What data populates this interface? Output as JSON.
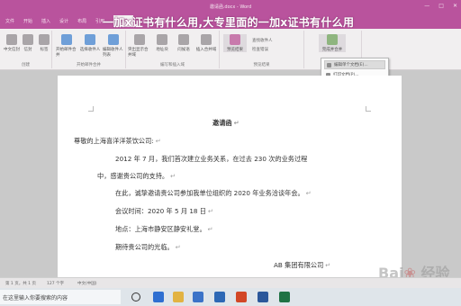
{
  "window": {
    "title": "邀请函.docx - Word",
    "controls": [
      "—",
      "□",
      "✕"
    ]
  },
  "headline": "一加x证书有什么用,大专里面的一加x证书有什么用",
  "tabs": [
    "文件",
    "开始",
    "插入",
    "设计",
    "布局",
    "引用",
    "邮件",
    "审阅",
    "视图"
  ],
  "active_tab": "邮件",
  "ribbon": {
    "groups": [
      {
        "label": "创建",
        "buttons": [
          "中文信封",
          "信封",
          "标签"
        ]
      },
      {
        "label": "开始邮件合并",
        "buttons": [
          "开始邮件合并",
          "选择收件人",
          "编辑收件人列表"
        ]
      },
      {
        "label": "编写和插入域",
        "buttons": [
          "突出显示合并域",
          "地址块",
          "问候语",
          "插入合并域"
        ]
      },
      {
        "label": "预览结果",
        "buttons": [
          "预览结果"
        ],
        "lines": [
          "查找收件人",
          "检查错误"
        ]
      },
      {
        "label": "完成",
        "buttons": [
          "完成并合并"
        ]
      }
    ]
  },
  "dropdown": {
    "items": [
      "编辑单个文档(E)...",
      "打印文档(P)...",
      "发送电子邮件(S)..."
    ],
    "selected_index": 0
  },
  "document": {
    "title": "邀请函",
    "paragraphs": [
      "尊敬的上海喜洋洋茶饮公司:",
      "2012 年 7 月，我们首次建立业务关系，在过去 230 次的业务过程",
      "中，感谢贵公司的支持。",
      "在此，诚挚邀请贵公司参加我单位组织的 2020 年业务洽谈年会。",
      "会议时间：2020 年 5 月 18 日",
      "地点：上海市静安区静安礼堂。",
      "期待贵公司的光临。",
      "AB 集团有限公司"
    ],
    "para_mark": "↵"
  },
  "statusbar": {
    "left": "第 1 页，共 1 页",
    "words": "127 个字",
    "language": "中文(中国)"
  },
  "taskbar": {
    "search_text": "在这里输入你要搜索的内容"
  },
  "watermark": "Bai 经验"
}
